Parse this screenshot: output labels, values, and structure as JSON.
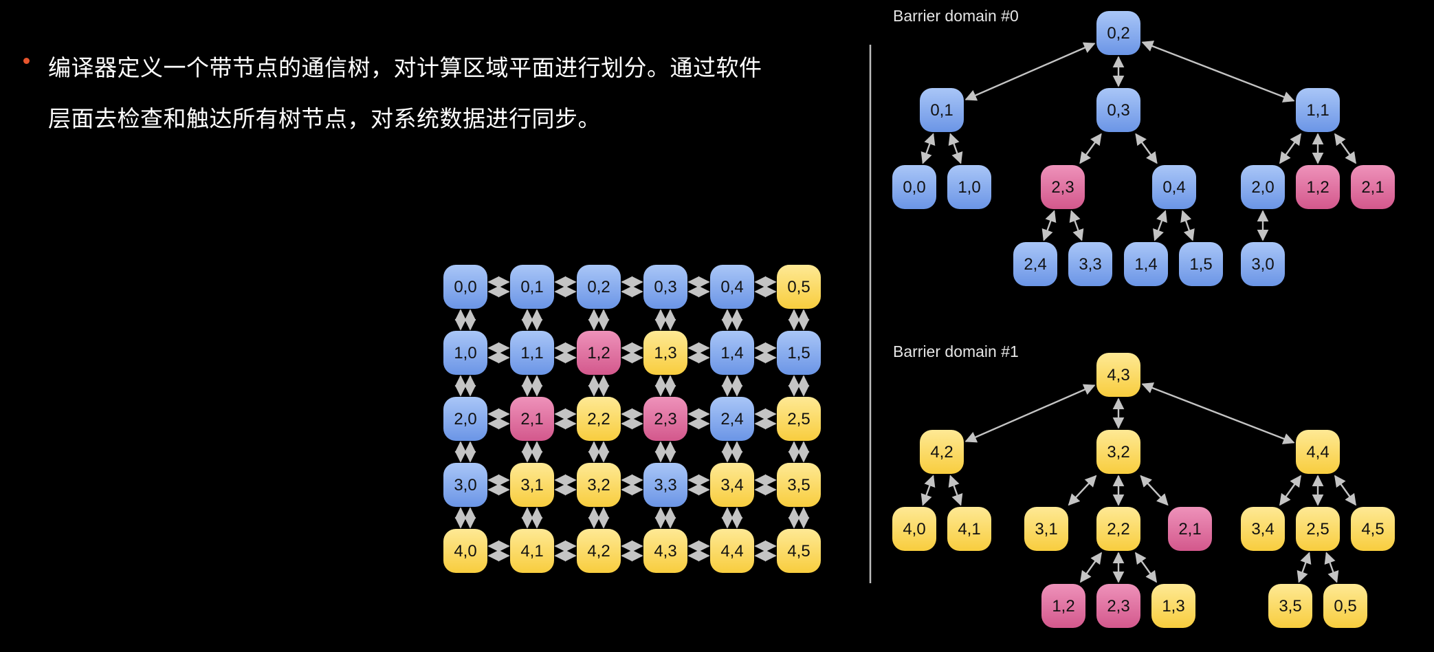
{
  "text": {
    "bullet_line_1": "编译器定义一个带节点的通信树，对计算区域平面进行划分。通过软件",
    "bullet_line_2": "层面去检查和触达所有树节点，对系统数据进行同步。"
  },
  "colors": {
    "blue": "#7ea6ee",
    "pink": "#df6a9c",
    "yellow": "#fdd95c",
    "arrow": "#c4c4c4",
    "divider": "#bdbdbd",
    "bullet": "#e8552d"
  },
  "grid": {
    "rows": [
      [
        {
          "label": "0,0",
          "color": "blue"
        },
        {
          "label": "0,1",
          "color": "blue"
        },
        {
          "label": "0,2",
          "color": "blue"
        },
        {
          "label": "0,3",
          "color": "blue"
        },
        {
          "label": "0,4",
          "color": "blue"
        },
        {
          "label": "0,5",
          "color": "yellow"
        }
      ],
      [
        {
          "label": "1,0",
          "color": "blue"
        },
        {
          "label": "1,1",
          "color": "blue"
        },
        {
          "label": "1,2",
          "color": "pink"
        },
        {
          "label": "1,3",
          "color": "yellow"
        },
        {
          "label": "1,4",
          "color": "blue"
        },
        {
          "label": "1,5",
          "color": "blue"
        }
      ],
      [
        {
          "label": "2,0",
          "color": "blue"
        },
        {
          "label": "2,1",
          "color": "pink"
        },
        {
          "label": "2,2",
          "color": "yellow"
        },
        {
          "label": "2,3",
          "color": "pink"
        },
        {
          "label": "2,4",
          "color": "blue"
        },
        {
          "label": "2,5",
          "color": "yellow"
        }
      ],
      [
        {
          "label": "3,0",
          "color": "blue"
        },
        {
          "label": "3,1",
          "color": "yellow"
        },
        {
          "label": "3,2",
          "color": "yellow"
        },
        {
          "label": "3,3",
          "color": "blue"
        },
        {
          "label": "3,4",
          "color": "yellow"
        },
        {
          "label": "3,5",
          "color": "yellow"
        }
      ],
      [
        {
          "label": "4,0",
          "color": "yellow"
        },
        {
          "label": "4,1",
          "color": "yellow"
        },
        {
          "label": "4,2",
          "color": "yellow"
        },
        {
          "label": "4,3",
          "color": "yellow"
        },
        {
          "label": "4,4",
          "color": "yellow"
        },
        {
          "label": "4,5",
          "color": "yellow"
        }
      ]
    ]
  },
  "trees": [
    {
      "title": "Barrier domain #0",
      "root": {
        "label": "0,2",
        "color": "blue",
        "children": [
          {
            "label": "0,1",
            "color": "blue",
            "children": [
              {
                "label": "0,0",
                "color": "blue"
              },
              {
                "label": "1,0",
                "color": "blue"
              }
            ]
          },
          {
            "label": "0,3",
            "color": "blue",
            "children": [
              {
                "label": "2,3",
                "color": "pink",
                "children": [
                  {
                    "label": "2,4",
                    "color": "blue"
                  },
                  {
                    "label": "3,3",
                    "color": "blue"
                  }
                ]
              },
              {
                "label": "0,4",
                "color": "blue",
                "children": [
                  {
                    "label": "1,4",
                    "color": "blue"
                  },
                  {
                    "label": "1,5",
                    "color": "blue"
                  }
                ]
              }
            ]
          },
          {
            "label": "1,1",
            "color": "blue",
            "children": [
              {
                "label": "2,0",
                "color": "blue",
                "children": [
                  {
                    "label": "3,0",
                    "color": "blue"
                  }
                ]
              },
              {
                "label": "1,2",
                "color": "pink"
              },
              {
                "label": "2,1",
                "color": "pink"
              }
            ]
          }
        ]
      }
    },
    {
      "title": "Barrier domain #1",
      "root": {
        "label": "4,3",
        "color": "yellow",
        "children": [
          {
            "label": "4,2",
            "color": "yellow",
            "children": [
              {
                "label": "4,0",
                "color": "yellow"
              },
              {
                "label": "4,1",
                "color": "yellow"
              }
            ]
          },
          {
            "label": "3,2",
            "color": "yellow",
            "children": [
              {
                "label": "3,1",
                "color": "yellow"
              },
              {
                "label": "2,2",
                "color": "yellow",
                "children": [
                  {
                    "label": "1,2",
                    "color": "pink"
                  },
                  {
                    "label": "2,3",
                    "color": "pink"
                  },
                  {
                    "label": "1,3",
                    "color": "yellow"
                  }
                ]
              },
              {
                "label": "2,1",
                "color": "pink"
              }
            ]
          },
          {
            "label": "4,4",
            "color": "yellow",
            "children": [
              {
                "label": "3,4",
                "color": "yellow"
              },
              {
                "label": "2,5",
                "color": "yellow",
                "children": [
                  {
                    "label": "3,5",
                    "color": "yellow"
                  },
                  {
                    "label": "0,5",
                    "color": "yellow"
                  }
                ]
              },
              {
                "label": "4,5",
                "color": "yellow"
              }
            ]
          }
        ]
      }
    }
  ]
}
